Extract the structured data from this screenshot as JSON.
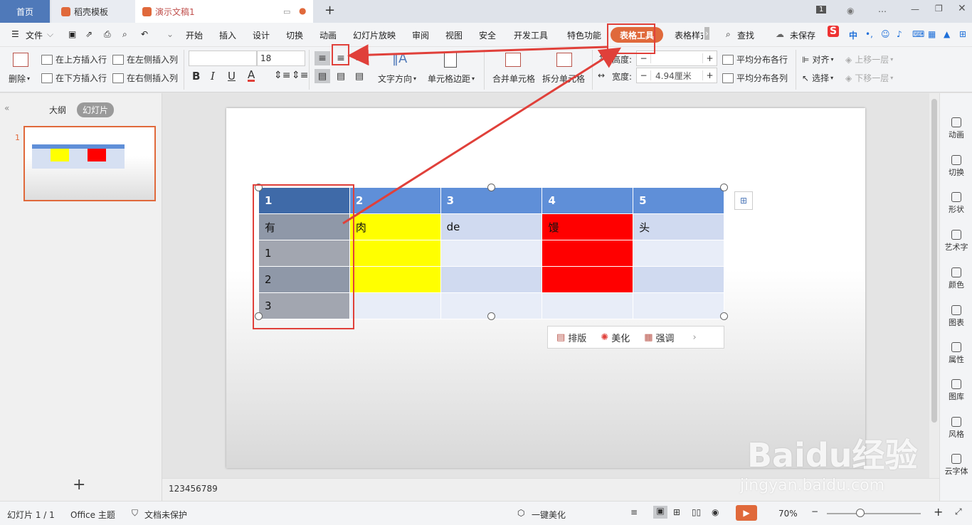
{
  "tabs": {
    "home": "首页",
    "template": "稻壳模板",
    "doc": "演示文稿1"
  },
  "title_badge": "1",
  "menu": {
    "file": "文件",
    "items": [
      "开始",
      "插入",
      "设计",
      "切换",
      "动画",
      "幻灯片放映",
      "审阅",
      "视图",
      "安全",
      "开发工具",
      "特色功能"
    ],
    "table_tools": "表格工具",
    "table_style": "表格样式",
    "find": "查找",
    "unsaved": "未保存",
    "ime": "中"
  },
  "ribbon": {
    "delete": "删除",
    "insert_above": "在上方插入行",
    "insert_below": "在下方插入行",
    "insert_left": "在左侧插入列",
    "insert_right": "在右侧插入列",
    "font_size": "18",
    "font_name": "",
    "text_dir": "文字方向",
    "cell_margin": "单元格边距",
    "merge": "合并单元格",
    "split": "拆分单元格",
    "height_label": "高度:",
    "height_value": "",
    "width_label": "宽度:",
    "width_value": "4.94厘米",
    "dist_rows": "平均分布各行",
    "dist_cols": "平均分布各列",
    "align": "对齐",
    "select": "选择",
    "bring_forward": "上移一层",
    "send_backward": "下移一层"
  },
  "left_panel": {
    "outline": "大纲",
    "slides": "幻灯片",
    "thumb_number": "1",
    "add": "+"
  },
  "table": {
    "header": [
      "1",
      "2",
      "3",
      "4",
      "5"
    ],
    "rows": [
      [
        "有",
        "肉",
        "de",
        "馒",
        "头"
      ],
      [
        "1",
        "",
        "",
        "",
        ""
      ],
      [
        "2",
        "",
        "",
        "",
        ""
      ],
      [
        "3",
        "",
        "",
        "",
        ""
      ]
    ]
  },
  "float_bar": {
    "layout": "排版",
    "beautify": "美化",
    "emphasize": "强调"
  },
  "right_panel": [
    "动画",
    "切换",
    "形状",
    "艺术字",
    "颜色",
    "图表",
    "属性",
    "图库",
    "风格",
    "云字体"
  ],
  "notes": "123456789",
  "status": {
    "slide": "幻灯片 1 / 1",
    "theme": "Office 主题",
    "protect": "文档未保护",
    "beautify": "一键美化",
    "zoom": "70%"
  },
  "colors": {
    "accent": "#e0693b",
    "header": "#5f8fd8",
    "yellow": "#ffff00",
    "red": "#ff0000",
    "annotation": "#e0403a"
  },
  "watermark": {
    "brand": "Baidu经验",
    "url": "jingyan.baidu.com"
  }
}
